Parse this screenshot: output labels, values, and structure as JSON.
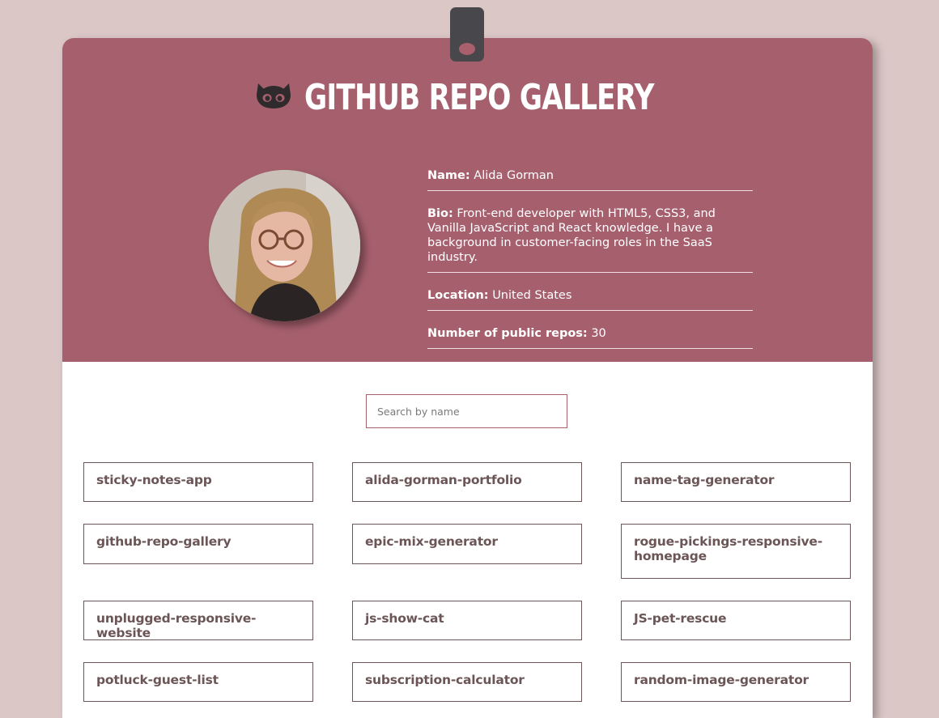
{
  "header": {
    "title": "GITHUB REPO GALLERY"
  },
  "profile": {
    "name_label": "Name:",
    "name": "Alida Gorman",
    "bio_label": "Bio:",
    "bio": "Front-end developer with HTML5, CSS3, and Vanilla JavaScript and React knowledge. I have a background in customer-facing roles in the SaaS industry.",
    "location_label": "Location:",
    "location": "United States",
    "repos_label": "Number of public repos:",
    "repos_count": "30"
  },
  "search": {
    "placeholder": "Search by name",
    "value": ""
  },
  "repos": [
    "sticky-notes-app",
    "alida-gorman-portfolio",
    "name-tag-generator",
    "github-repo-gallery",
    "epic-mix-generator",
    "rogue-pickings-responsive-homepage",
    "unplugged-responsive-website",
    "js-show-cat",
    "JS-pet-rescue",
    "potluck-guest-list",
    "subscription-calculator",
    "random-image-generator"
  ],
  "icons": {
    "logo": "github-octocat-icon",
    "clip": "badge-clip-icon"
  },
  "colors": {
    "page_bg": "#dbc7c6",
    "header_bg": "#a6606d",
    "repo_text": "#6b5557",
    "clip": "#48474b"
  }
}
